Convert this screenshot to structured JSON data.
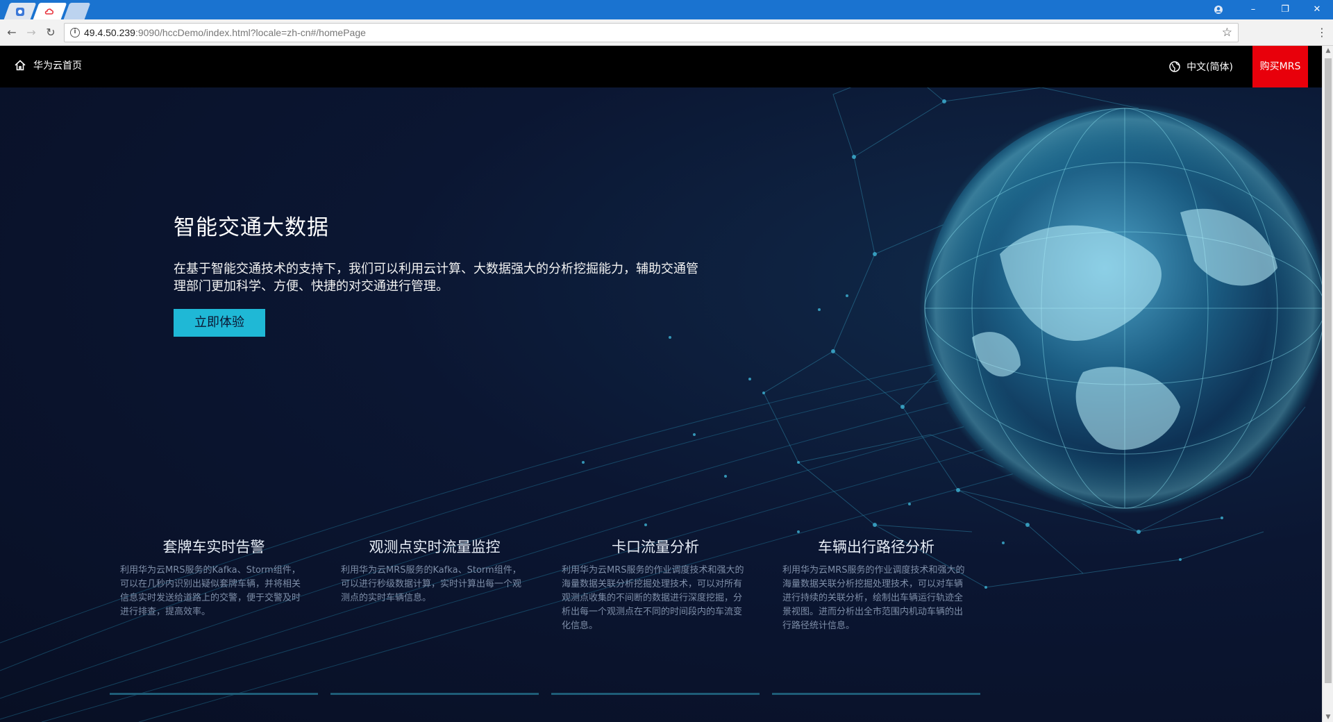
{
  "browser": {
    "url_host": "49.4.50.239",
    "url_rest": ":9090/hccDemo/index.html?locale=zh-cn#/homePage",
    "win_controls": [
      "–",
      "❐",
      "✕"
    ]
  },
  "nav": {
    "home_label": "华为云首页",
    "lang_label": "中文(简体)",
    "buy_label": "购买MRS"
  },
  "hero": {
    "title": "智能交通大数据",
    "description": "在基于智能交通技术的支持下，我们可以利用云计算、大数据强大的分析挖掘能力，辅助交通管理部门更加科学、方便、快捷的对交通进行管理。",
    "cta_label": "立即体验"
  },
  "features": [
    {
      "title": "套牌车实时告警",
      "text": "利用华为云MRS服务的Kafka、Storm组件，可以在几秒内识别出疑似套牌车辆，并将相关信息实时发送给道路上的交警，便于交警及时进行排查，提高效率。"
    },
    {
      "title": "观测点实时流量监控",
      "text": "利用华为云MRS服务的Kafka、Storm组件，可以进行秒级数据计算，实时计算出每一个观测点的实时车辆信息。"
    },
    {
      "title": "卡口流量分析",
      "text": "利用华为云MRS服务的作业调度技术和强大的海量数据关联分析挖掘处理技术，可以对所有观测点收集的不间断的数据进行深度挖掘，分析出每一个观测点在不同的时间段内的车流变化信息。"
    },
    {
      "title": "车辆出行路径分析",
      "text": "利用华为云MRS服务的作业调度技术和强大的海量数据关联分析挖掘处理技术，可以对车辆进行持续的关联分析，绘制出车辆运行轨迹全景视图。进而分析出全市范围内机动车辆的出行路径统计信息。"
    }
  ],
  "colors": {
    "accent": "#1fb8d6",
    "buy": "#e8000b",
    "background": "#0a1128"
  }
}
